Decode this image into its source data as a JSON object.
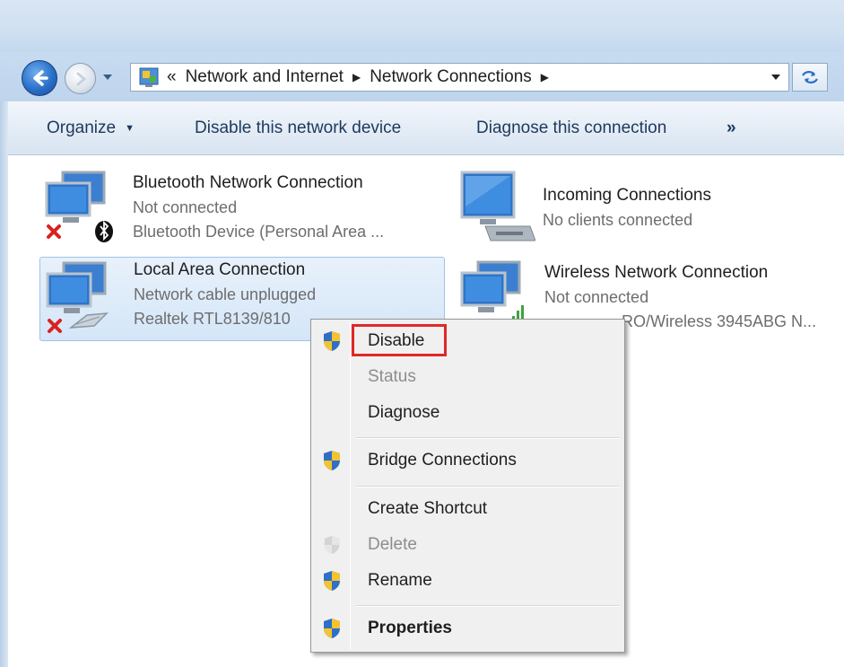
{
  "address_bar": {
    "overflow": "«",
    "breadcrumbs": [
      "Network and Internet",
      "Network Connections"
    ]
  },
  "command_bar": {
    "organize": "Organize",
    "disable_device": "Disable this network device",
    "diagnose_connection": "Diagnose this connection",
    "more": "»"
  },
  "connections": [
    {
      "name": "Bluetooth Network Connection",
      "status": "Not connected",
      "device": "Bluetooth Device (Personal Area ...",
      "icon": "bluetooth-network-icon",
      "error": true
    },
    {
      "name": "Incoming Connections",
      "status": "No clients connected",
      "device": "",
      "icon": "incoming-connections-icon",
      "error": false
    },
    {
      "name": "Local Area Connection",
      "status": "Network cable unplugged",
      "device": "Realtek RTL8139/810",
      "icon": "ethernet-network-icon",
      "error": true,
      "selected": true
    },
    {
      "name": "Wireless Network Connection",
      "status": "Not connected",
      "device": "RO/Wireless 3945ABG N...",
      "icon": "wireless-network-icon",
      "error": true
    }
  ],
  "context_menu": {
    "items": [
      {
        "label": "Disable",
        "shield": true,
        "enabled": true,
        "bold": false
      },
      {
        "label": "Status",
        "shield": false,
        "enabled": false,
        "bold": false
      },
      {
        "label": "Diagnose",
        "shield": false,
        "enabled": true,
        "bold": false
      },
      {
        "label": "Bridge Connections",
        "shield": true,
        "enabled": true,
        "bold": false
      },
      {
        "label": "Create Shortcut",
        "shield": false,
        "enabled": true,
        "bold": false
      },
      {
        "label": "Delete",
        "shield": true,
        "enabled": false,
        "bold": false
      },
      {
        "label": "Rename",
        "shield": true,
        "enabled": true,
        "bold": false
      },
      {
        "label": "Properties",
        "shield": true,
        "enabled": true,
        "bold": true
      }
    ],
    "highlighted": "Disable"
  },
  "colors": {
    "highlight_box": "#e02727",
    "error_x": "#d8231f",
    "selection_border": "#9cc3e9"
  }
}
